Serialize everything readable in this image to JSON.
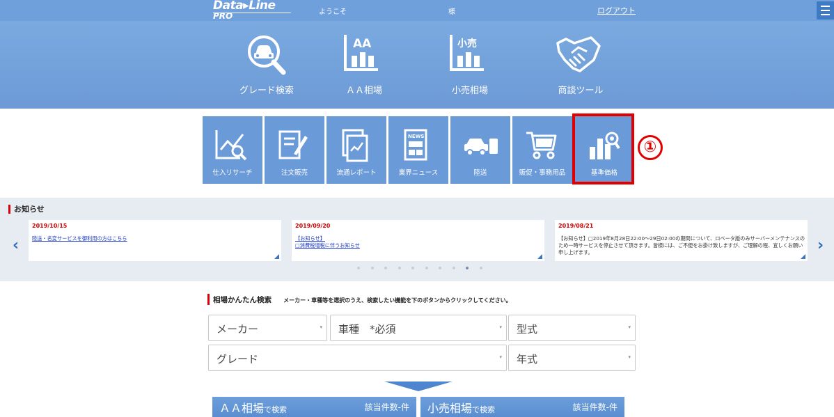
{
  "header": {
    "logo_main": "Data▸Line",
    "logo_sub": "PRO",
    "welcome": "ようこそ",
    "honorific": "様",
    "logout": "ログアウト",
    "menu_icon": "hamburger-icon"
  },
  "main_nav": [
    {
      "label": "グレード検索",
      "icon": "car-search-icon"
    },
    {
      "label": "ＡＡ相場",
      "icon": "aa-chart-icon"
    },
    {
      "label": "小売相場",
      "icon": "retail-chart-icon"
    },
    {
      "label": "商談ツール",
      "icon": "handshake-icon"
    }
  ],
  "icon_text": {
    "aa": "AA",
    "retail": "小売",
    "news": "NEWS"
  },
  "tiles": [
    {
      "label": "仕入リサーチ",
      "icon": "research-icon"
    },
    {
      "label": "注文販売",
      "icon": "order-icon"
    },
    {
      "label": "流通レポート",
      "icon": "report-icon"
    },
    {
      "label": "業界ニュース",
      "icon": "news-icon"
    },
    {
      "label": "陸送",
      "icon": "truck-icon"
    },
    {
      "label": "販促・事務用品",
      "icon": "cart-icon"
    },
    {
      "label": "基準価格",
      "icon": "price-chart-icon"
    }
  ],
  "annotation": {
    "marker": "①",
    "color": "#e00000"
  },
  "news": {
    "heading": "お知らせ",
    "cards": [
      {
        "date": "2019/10/15",
        "text": "陸送・名変サービスを御利用の方はこちら"
      },
      {
        "date": "2019/09/20",
        "text_line1": "【お知らせ】",
        "text_line2": "□消費税増税に伴うお知らせ"
      },
      {
        "date": "2019/08/21",
        "text": "【お知らせ】□2019年8月28日22:00～29日02:00の期間について、ロベータ版のみサーバーメンテナンスのため一時サービスを停止させて頂きます。皆様には、ご不便をお掛け致しますが、ご理解の程、宜しくお願い申し上げます。"
      }
    ],
    "prev_arrow": "‹",
    "next_arrow": "›",
    "page_count": 10,
    "active_page": 9
  },
  "search": {
    "heading": "相場かんたん検索",
    "note": "メーカー・車種等を選択のうえ、検索したい機能を下のボタンからクリックしてください。",
    "maker": "メーカー",
    "model": "車種　*必須",
    "type": "型式",
    "grade": "グレード",
    "year": "年式",
    "caret": "▾"
  },
  "buttons": {
    "aa_main": "ＡＡ相場",
    "aa_sub": "で検索",
    "aa_count": "該当件数-件",
    "retail_main": "小売相場",
    "retail_sub": "で検索",
    "retail_count": "該当件数-件"
  },
  "colors": {
    "primary": "#6fa0dc",
    "accent": "#d9000d",
    "link": "#1a37c8"
  }
}
